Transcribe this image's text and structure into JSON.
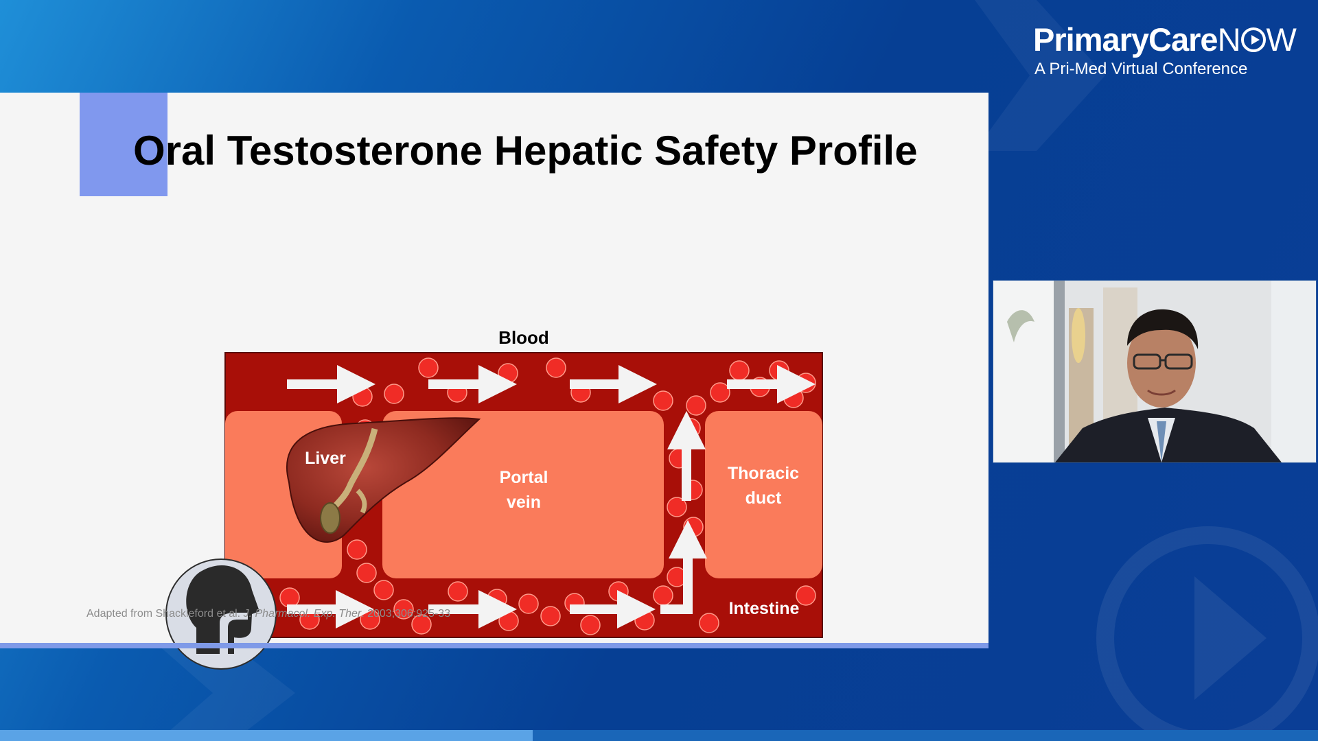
{
  "brand": {
    "name_bold": "PrimaryCare",
    "name_light_before": "N",
    "name_light_after": "W",
    "tagline": "A Pri-Med Virtual Conference"
  },
  "slide": {
    "title": "Oral Testosterone Hepatic Safety Profile",
    "citation": {
      "prefix": "Adapted from Shackleford et al. ",
      "journal": "J. Pharmacol. Exp. Ther",
      "suffix": ". 2003;306:925-33"
    }
  },
  "diagram": {
    "blood_label": "Blood",
    "liver_label": "Liver",
    "portal_label_line1": "Portal",
    "portal_label_line2": "vein",
    "thoracic_label_line1": "Thoracic",
    "thoracic_label_line2": "duct",
    "intestine_label": "Intestine",
    "colors": {
      "blood": "#a80f08",
      "tissue": "#fa7b5b",
      "cell": "#f02c26",
      "arrow": "#f3f3f3"
    }
  },
  "colors": {
    "slide_bg": "#f5f5f5",
    "accent": "#8098ee",
    "background": "#063f94"
  },
  "icons": [
    "play-circle-icon",
    "head-swallow-icon",
    "liver-icon"
  ]
}
